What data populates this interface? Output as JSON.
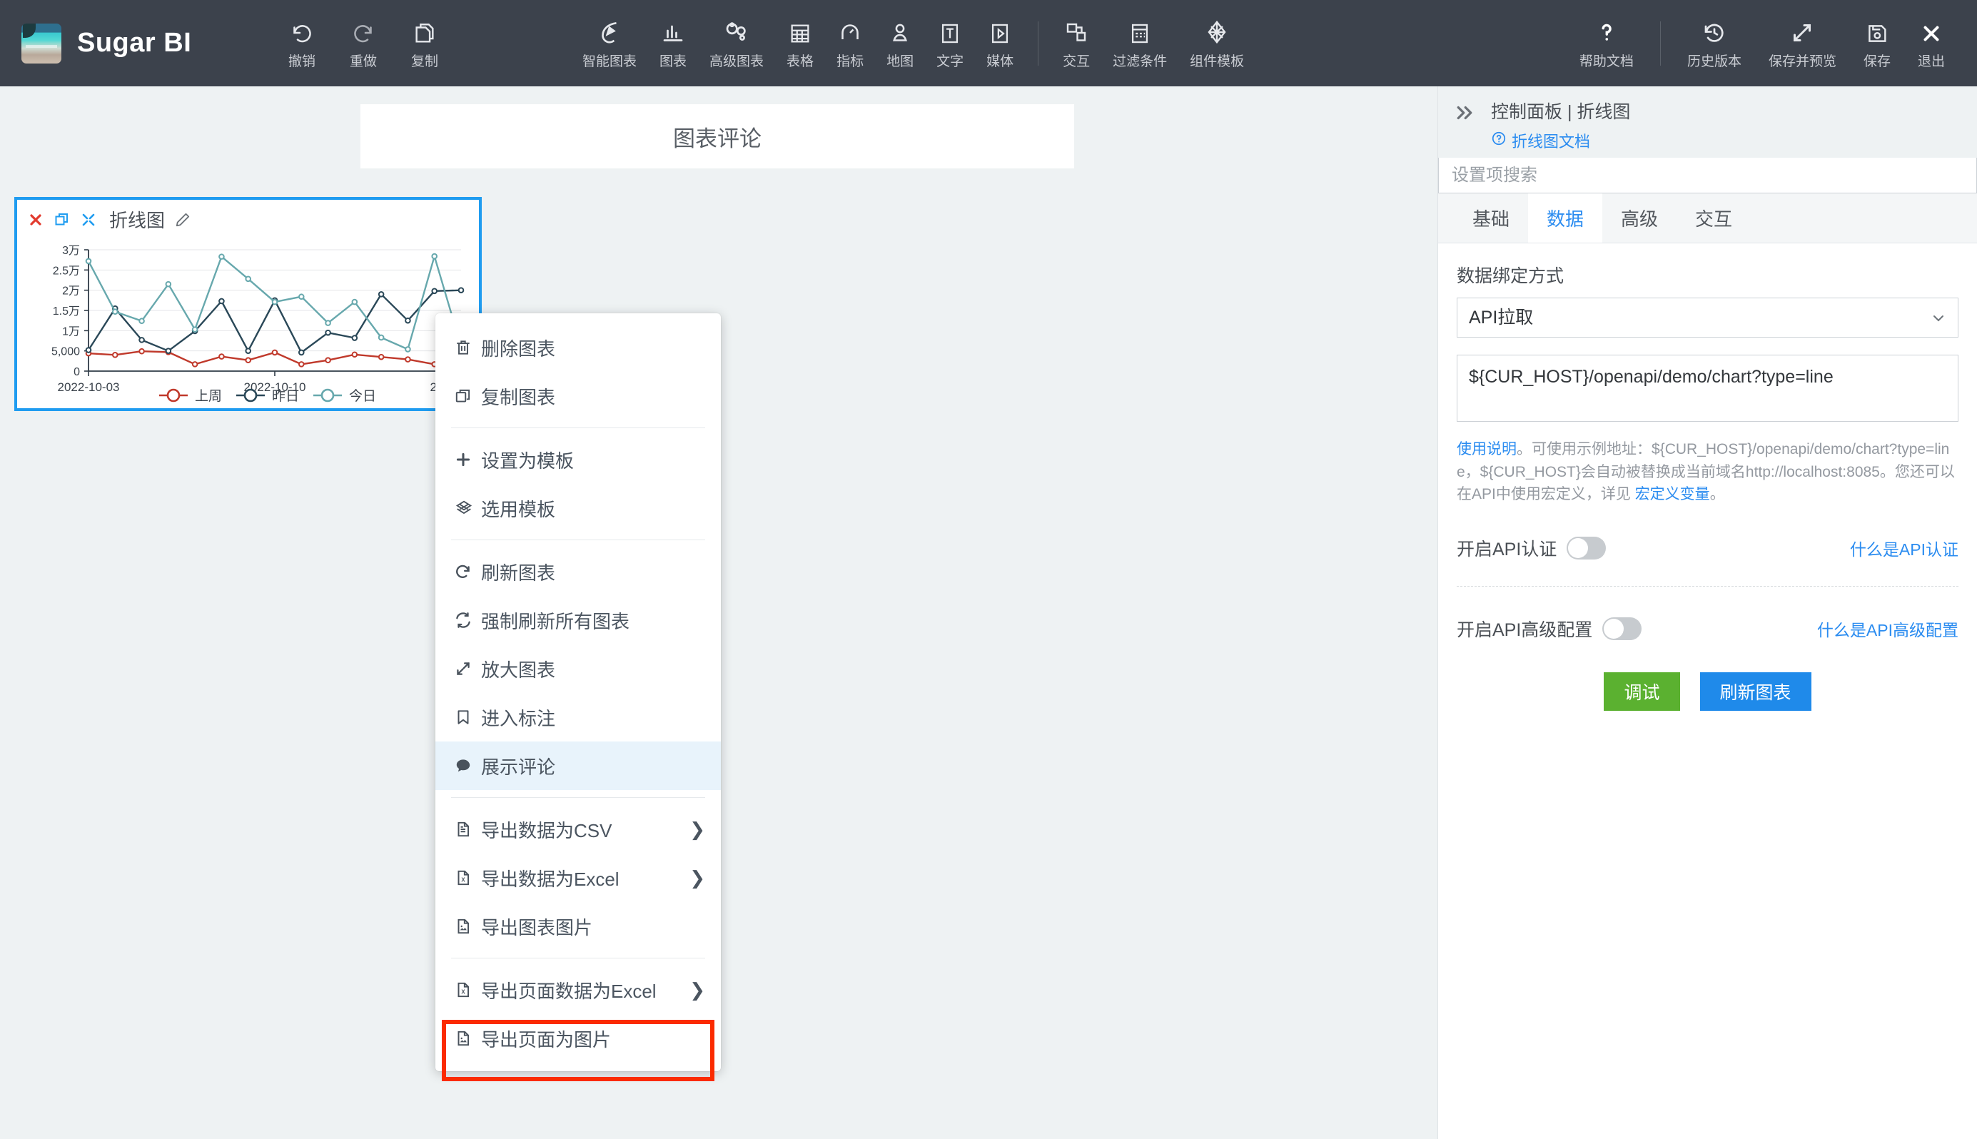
{
  "app": {
    "name": "Sugar BI",
    "logo_icon": "beach-photo-logo"
  },
  "toolbar": {
    "left": [
      {
        "label": "撤销",
        "icon": "undo-icon"
      },
      {
        "label": "重做",
        "icon": "redo-icon"
      },
      {
        "label": "复制",
        "icon": "copy-icon"
      }
    ],
    "center": [
      {
        "label": "智能图表",
        "icon": "smart-chart-icon"
      },
      {
        "label": "图表",
        "icon": "bar-chart-icon"
      },
      {
        "label": "高级图表",
        "icon": "advanced-chart-icon"
      },
      {
        "label": "表格",
        "icon": "table-icon"
      },
      {
        "label": "指标",
        "icon": "metric-icon"
      },
      {
        "label": "地图",
        "icon": "map-icon"
      },
      {
        "label": "文字",
        "icon": "text-icon"
      },
      {
        "label": "媒体",
        "icon": "media-icon"
      }
    ],
    "center2": [
      {
        "label": "交互",
        "icon": "interaction-icon"
      },
      {
        "label": "过滤条件",
        "icon": "filter-icon"
      },
      {
        "label": "组件模板",
        "icon": "component-template-icon"
      }
    ],
    "right1": [
      {
        "label": "帮助文档",
        "icon": "question-mark-icon"
      }
    ],
    "right2": [
      {
        "label": "历史版本",
        "icon": "history-icon"
      },
      {
        "label": "保存并预览",
        "icon": "expand-arrows-icon"
      },
      {
        "label": "保存",
        "icon": "save-disk-icon"
      },
      {
        "label": "退出",
        "icon": "close-x-icon"
      }
    ]
  },
  "canvas": {
    "page_title": "图表评论",
    "widget": {
      "title": "折线图",
      "actions": [
        {
          "icon": "close-x-icon",
          "name": "delete-widget"
        },
        {
          "icon": "copy-icon",
          "name": "copy-widget"
        },
        {
          "icon": "resize-icon",
          "name": "resize-widget"
        }
      ],
      "edit_icon": "pencil-icon"
    }
  },
  "context_menu": {
    "items": [
      {
        "label": "删除图表",
        "icon": "trash-icon",
        "arrow": false,
        "divider_after": false
      },
      {
        "label": "复制图表",
        "icon": "copy-icon",
        "arrow": false,
        "divider_after": true
      },
      {
        "label": "设置为模板",
        "icon": "plus-icon",
        "arrow": false,
        "divider_after": false
      },
      {
        "label": "选用模板",
        "icon": "template-icon",
        "arrow": false,
        "divider_after": true
      },
      {
        "label": "刷新图表",
        "icon": "refresh-icon",
        "arrow": false,
        "divider_after": false
      },
      {
        "label": "强制刷新所有图表",
        "icon": "sync-icon",
        "arrow": false,
        "divider_after": false
      },
      {
        "label": "放大图表",
        "icon": "expand-arrows-icon",
        "arrow": false,
        "divider_after": false
      },
      {
        "label": "进入标注",
        "icon": "bookmark-icon",
        "arrow": false,
        "divider_after": false
      },
      {
        "label": "展示评论",
        "icon": "comment-bubble-icon",
        "arrow": false,
        "divider_after": true,
        "selected": true
      },
      {
        "label": "导出数据为CSV",
        "icon": "file-text-icon",
        "arrow": true,
        "divider_after": false
      },
      {
        "label": "导出数据为Excel",
        "icon": "file-excel-icon",
        "arrow": true,
        "divider_after": false
      },
      {
        "label": "导出图表图片",
        "icon": "file-image-icon",
        "arrow": false,
        "divider_after": true
      },
      {
        "label": "导出页面数据为Excel",
        "icon": "file-excel-icon",
        "arrow": true,
        "divider_after": false
      },
      {
        "label": "导出页面为图片",
        "icon": "file-image-icon",
        "arrow": false,
        "divider_after": false
      }
    ],
    "highlight_color": "#fb2b00",
    "selected_bg": "#e8f3fb"
  },
  "right_panel": {
    "collapse_icon": "double-chevron-right-icon",
    "breadcrumb": "控制面板 | 折线图",
    "doc_link": "折线图文档",
    "doc_link_icon": "question-circle-icon",
    "search_placeholder": "设置项搜索",
    "search_value": "",
    "tabs": [
      {
        "label": "基础",
        "active": false
      },
      {
        "label": "数据",
        "active": true
      },
      {
        "label": "高级",
        "active": false
      },
      {
        "label": "交互",
        "active": false
      }
    ],
    "binding_label": "数据绑定方式",
    "binding_value": "API拉取",
    "binding_options": [
      "API拉取"
    ],
    "api_url": "${CUR_HOST}/openapi/demo/chart?type=line",
    "hint": {
      "link1": "使用说明",
      "text1": "。可使用示例地址：${CUR_HOST}/openapi/demo/chart?type=line，${CUR_HOST}会自动被替换成当前域名http://localhost:8085。您还可以在API中使用宏定义，详见 ",
      "link2": "宏定义变量",
      "text2": "。"
    },
    "toggles": [
      {
        "label": "开启API认证",
        "on": false,
        "link": "什么是API认证"
      },
      {
        "label": "开启API高级配置",
        "on": false,
        "link": "什么是API高级配置"
      }
    ],
    "buttons": [
      {
        "label": "调试",
        "color": "#5bb130"
      },
      {
        "label": "刷新图表",
        "color": "#1f8aea"
      }
    ]
  },
  "chart_data": {
    "type": "line",
    "title": "",
    "xlabel": "",
    "ylabel": "",
    "grid": true,
    "legend_position": "bottom",
    "ylim": [
      0,
      30000
    ],
    "ytick_labels": [
      "0",
      "5,000",
      "1万",
      "1.5万",
      "2万",
      "2.5万",
      "3万"
    ],
    "ytick_values": [
      0,
      5000,
      10000,
      15000,
      20000,
      25000,
      30000
    ],
    "x": [
      "2022-10-03",
      "2022-10-04",
      "2022-10-05",
      "2022-10-06",
      "2022-10-07",
      "2022-10-08",
      "2022-10-09",
      "2022-10-10",
      "2022-10-11",
      "2022-10-12",
      "2022-10-13",
      "2022-10-14",
      "2022-10-15",
      "2022-10-16",
      "2022-10-17"
    ],
    "xtick_labels": [
      "2022-10-03",
      "2022-10-10",
      "2022-10-17"
    ],
    "xtick_indices": [
      0,
      7,
      14
    ],
    "series": [
      {
        "name": "上周",
        "color": "#c0392b",
        "values": [
          4400,
          4000,
          4900,
          4700,
          1700,
          3600,
          2700,
          4600,
          1700,
          2700,
          4100,
          3500,
          2900,
          1700,
          2400
        ]
      },
      {
        "name": "昨日",
        "color": "#2a4858",
        "values": [
          5200,
          15500,
          7700,
          5000,
          9900,
          17300,
          5000,
          17500,
          4600,
          9500,
          8200,
          19000,
          12500,
          19800,
          20000
        ]
      },
      {
        "name": "今日",
        "color": "#67a8ad",
        "values": [
          27200,
          14700,
          12400,
          21500,
          10300,
          28300,
          22800,
          17100,
          18400,
          11900,
          17100,
          8300,
          5400,
          28400,
          6100
        ]
      }
    ]
  }
}
